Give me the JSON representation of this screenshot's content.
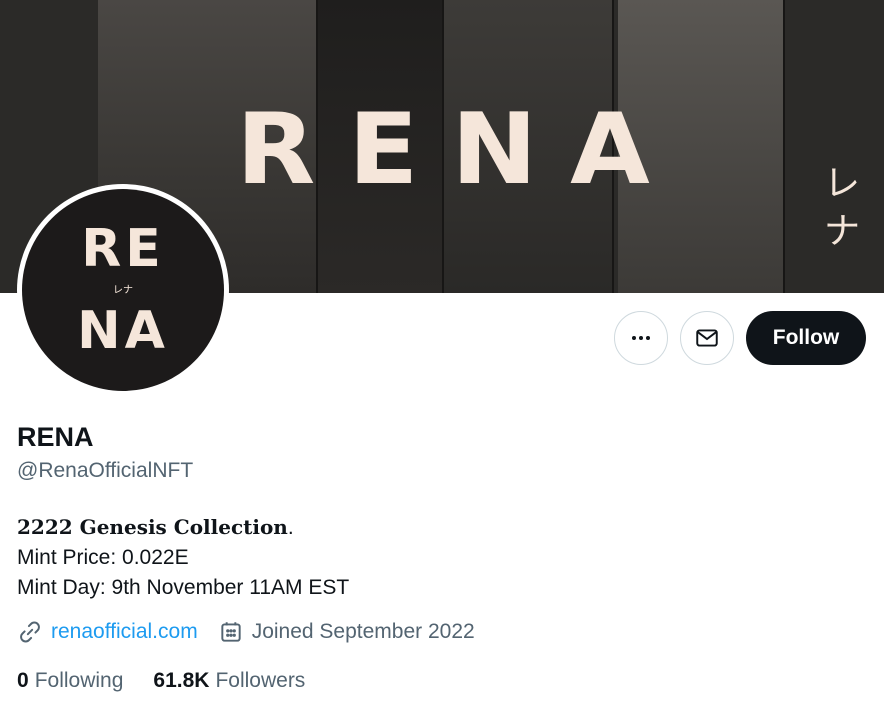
{
  "banner": {
    "title_letters": [
      "R",
      "E",
      "N",
      "A"
    ],
    "kana": [
      "レ",
      "ナ"
    ]
  },
  "avatar": {
    "line1": "RE",
    "kana": "レナ",
    "line2": "NA"
  },
  "actions": {
    "follow_label": "Follow"
  },
  "profile": {
    "name": "RENA",
    "handle": "@RenaOfficialNFT",
    "bio": {
      "line1": "2222 Genesis Collection",
      "line1_suffix": ".",
      "line2": "Mint Price: 0.022E",
      "line3": "Mint Day: 9th November 11AM EST"
    },
    "website": "renaofficial.com",
    "joined": "Joined September 2022"
  },
  "stats": {
    "following_count": "0",
    "following_label": "Following",
    "followers_count": "61.8K",
    "followers_label": "Followers"
  },
  "colors": {
    "accent_link": "#1d9bf0",
    "follow_button_bg": "#0f1419",
    "secondary_text": "#536471",
    "banner_text": "#f5e6da"
  },
  "icons": [
    "more-icon",
    "mail-icon",
    "link-icon",
    "calendar-icon"
  ]
}
